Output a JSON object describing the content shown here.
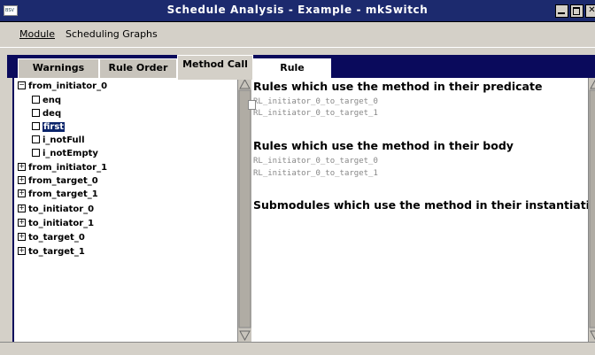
{
  "window": {
    "title": "Schedule Analysis - Example - mkSwitch",
    "sys_icon_text": "BSV"
  },
  "menubar": {
    "module": "Module",
    "scheduling_graphs": "Scheduling Graphs"
  },
  "tabs": {
    "warnings": "Warnings",
    "rule_order": "Rule Order",
    "method_call": "Method Call",
    "rule_relations": "Rule Relations"
  },
  "tree": {
    "root": "from_initiator_0",
    "children": [
      "enq",
      "deq",
      "first",
      "i_notFull",
      "i_notEmpty"
    ],
    "selected": "first",
    "collapsed": [
      "from_initiator_1",
      "from_target_0",
      "from_target_1",
      "to_initiator_0",
      "to_initiator_1",
      "to_target_0",
      "to_target_1"
    ]
  },
  "details": {
    "predicate_heading": "Rules which use the method  in their predicate",
    "predicate_rules": [
      "RL_initiator_0_to_target_0",
      "RL_initiator_0_to_target_1"
    ],
    "body_heading": "Rules which use the method  in their body",
    "body_rules": [
      "RL_initiator_0_to_target_0",
      "RL_initiator_0_to_target_1"
    ],
    "submodules_heading": "Submodules which use the method  in their instantiations"
  }
}
